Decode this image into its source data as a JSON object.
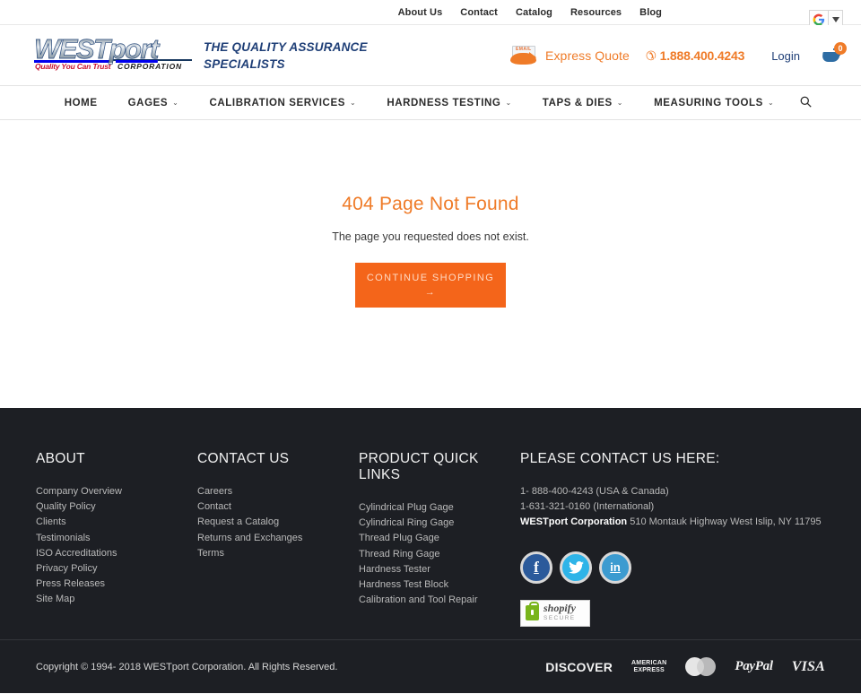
{
  "topbar": {
    "links": [
      {
        "label": "About Us"
      },
      {
        "label": "Contact"
      },
      {
        "label": "Catalog"
      },
      {
        "label": "Resources"
      },
      {
        "label": "Blog"
      }
    ],
    "translate": {
      "icon": "google-g-icon",
      "glyph": "G",
      "arrow": "▼"
    }
  },
  "header": {
    "logo": {
      "main_west": "WEST",
      "main_port": "port",
      "sub": "Quality You Can Trust",
      "corp": "CORPORATION"
    },
    "tagline_line1": "THE QUALITY ASSURANCE",
    "tagline_line2": "SPECIALISTS",
    "email_icon_label": "EMAIL",
    "express_quote": "Express Quote",
    "phone_icon": "phone-icon",
    "phone": "1.888.400.4243",
    "login": "Login",
    "cart_count": "0"
  },
  "nav": {
    "items": [
      {
        "label": "HOME",
        "caret": false
      },
      {
        "label": "GAGES",
        "caret": true
      },
      {
        "label": "CALIBRATION SERVICES",
        "caret": true
      },
      {
        "label": "HARDNESS TESTING",
        "caret": true
      },
      {
        "label": "TAPS & DIES",
        "caret": true
      },
      {
        "label": "MEASURING TOOLS",
        "caret": true
      }
    ],
    "caret_glyph": "⌄",
    "search_glyph": "⌕"
  },
  "main": {
    "title": "404 Page Not Found",
    "subtitle": "The page you requested does not exist.",
    "button_label": "CONTINUE SHOPPING",
    "button_arrow": "→"
  },
  "footer": {
    "about": {
      "title": "ABOUT",
      "links": [
        "Company Overview",
        "Quality Policy",
        "Clients",
        "Testimonials",
        "ISO Accreditations",
        "Privacy Policy",
        "Press Releases",
        "Site Map"
      ]
    },
    "contact": {
      "title": "CONTACT US",
      "links": [
        "Careers",
        "Contact",
        "Request a Catalog",
        "Returns and Exchanges",
        "Terms"
      ]
    },
    "products": {
      "title": "PRODUCT QUICK LINKS",
      "links": [
        "Cylindrical Plug Gage",
        "Cylindrical Ring Gage",
        "Thread Plug Gage",
        "Thread Ring Gage",
        "Hardness Tester",
        "Hardness Test Block",
        "Calibration and Tool Repair"
      ]
    },
    "contact_here": {
      "title": "PLEASE CONTACT US HERE:",
      "phone_usa": "1- 888-400-4243 (USA & Canada)",
      "phone_intl": "1-631-321-0160 (International)",
      "company": "WESTport Corporation",
      "address": " 510 Montauk Highway West Islip, NY 11795",
      "socials": [
        {
          "name": "facebook-icon",
          "glyph": "f"
        },
        {
          "name": "twitter-icon",
          "glyph": "🐦"
        },
        {
          "name": "linkedin-icon",
          "glyph": "in"
        }
      ],
      "shopify": {
        "name": "shopify",
        "secure": "SECURE"
      }
    }
  },
  "bottom": {
    "copyright": "Copyright © 1994- 2018 WESTport Corporation. All Rights Reserved.",
    "payments": [
      {
        "name": "discover-icon",
        "label": "DISCOVER"
      },
      {
        "name": "amex-icon",
        "label1": "AMERICAN",
        "label2": "EXPRESS"
      },
      {
        "name": "mastercard-icon",
        "label": ""
      },
      {
        "name": "paypal-icon",
        "label": "PayPal"
      },
      {
        "name": "visa-icon",
        "label": "VISA"
      }
    ]
  },
  "colors": {
    "accent_orange": "#ef7b28",
    "button_orange": "#f4651a",
    "brand_blue": "#1f3f77",
    "footer_bg": "#1d1f24"
  }
}
